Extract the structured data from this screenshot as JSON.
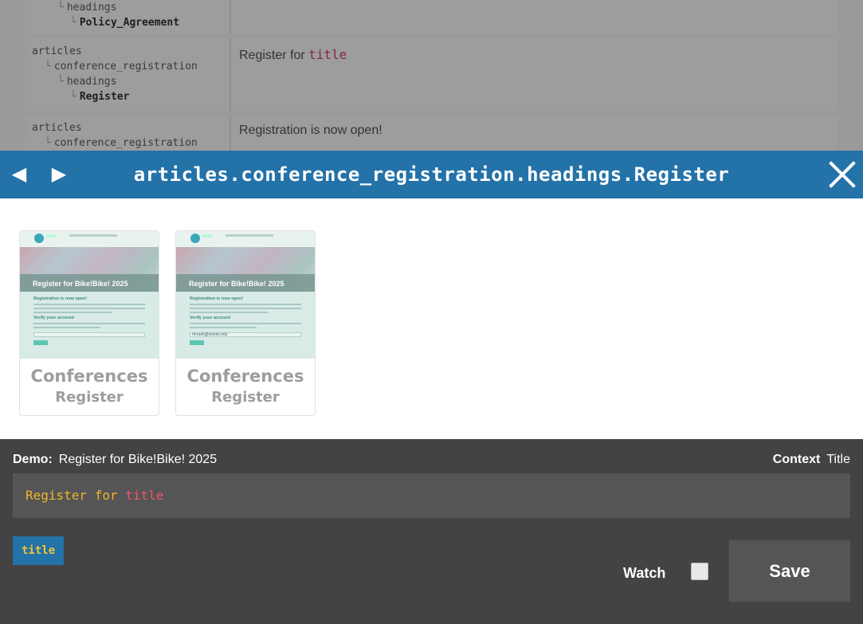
{
  "background_table": {
    "rows": [
      {
        "key_lines": [
          "headings",
          "Policy_Agreement"
        ],
        "value_prefix": "",
        "value_token": ""
      },
      {
        "key_lines": [
          "articles",
          "conference_registration",
          "headings",
          "Register"
        ],
        "value_prefix": "Register for ",
        "value_token": "title"
      },
      {
        "key_lines": [
          "articles",
          "conference_registration"
        ],
        "value_prefix": "Registration is now open!",
        "value_token": ""
      }
    ]
  },
  "header": {
    "title": "articles.conference_registration.headings.Register",
    "prev_icon": "◀",
    "next_icon": "▶",
    "close_icon": "close-icon"
  },
  "cards": [
    {
      "line1": "Conferences",
      "line2": "Register",
      "thumb_title": "Register for Bike!Bike! 2025",
      "thumb_heading": "Registration is now open!",
      "thumb_sub": "Verify your account",
      "thumb_input": ""
    },
    {
      "line1": "Conferences",
      "line2": "Register",
      "thumb_title": "Register for Bike!Bike! 2025",
      "thumb_heading": "Registration is now open!",
      "thumb_sub": "Verify your account",
      "thumb_input": "rtnrush@weeks.edu"
    }
  ],
  "editor": {
    "demo_label": "Demo:",
    "demo_value": "Register for Bike!Bike! 2025",
    "context_label": "Context",
    "context_value": "Title",
    "input_word": "Register for ",
    "input_var": "title",
    "variable_chip": "title",
    "watch_label": "Watch",
    "save_label": "Save"
  },
  "colors": {
    "header_bg": "#2372a8",
    "editor_bg": "#434343",
    "var_color": "#f4526d",
    "text_color": "#f0b32b"
  }
}
